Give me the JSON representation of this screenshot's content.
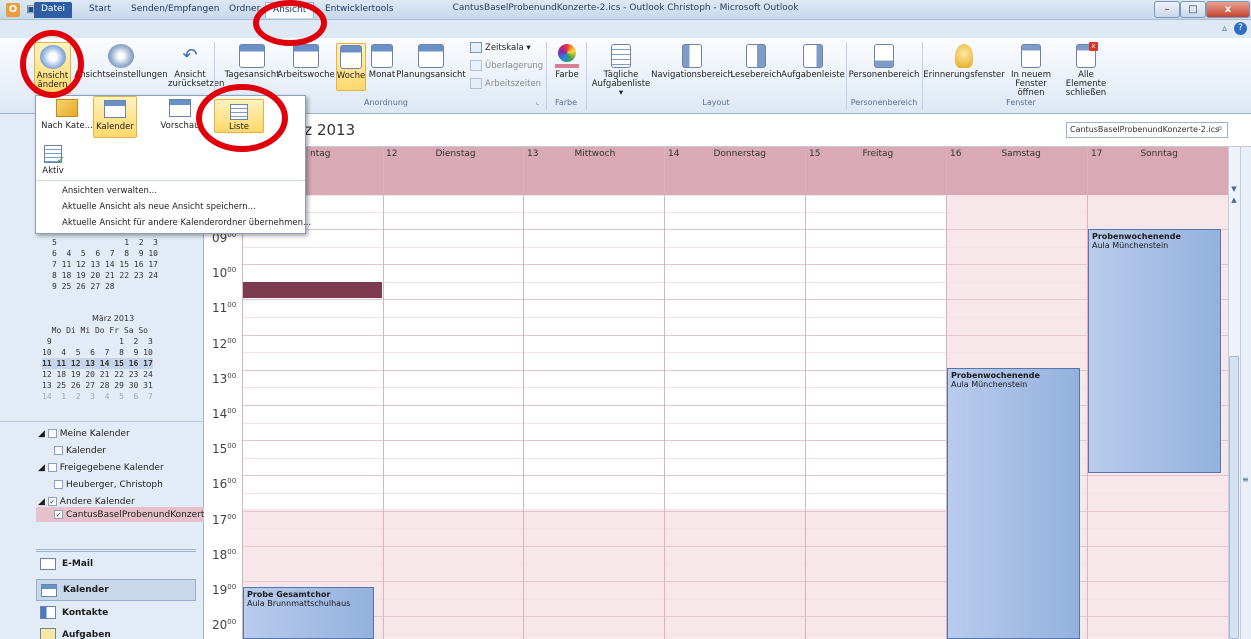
{
  "window": {
    "title": "CantusBaselProbenundKonzerte-2.ics - Outlook Christoph - Microsoft Outlook"
  },
  "qat": {
    "save_icon": "save-icon",
    "undo_icon": "undo-icon"
  },
  "window_controls": {
    "minimize": "–",
    "maximize": "□",
    "close": "x"
  },
  "tabs": [
    {
      "label": "Datei"
    },
    {
      "label": "Start"
    },
    {
      "label": "Senden/Empfangen"
    },
    {
      "label": "Ordner"
    },
    {
      "label": "Ansicht"
    },
    {
      "label": "Entwicklertools"
    }
  ],
  "ribbon": {
    "ansicht_aendern": "Ansicht ändern",
    "ansichtseinstellungen": "Ansichtseinstellungen",
    "ansicht_zuruecksetzen": "Ansicht zurücksetzen",
    "tagesansicht": "Tagesansicht",
    "arbeitswoche": "Arbeitswoche",
    "woche": "Woche",
    "monat": "Monat",
    "planungsansicht": "Planungsansicht",
    "zeitskala": "Zeitskala ▾",
    "ueberlagerung": "Überlagerung",
    "arbeitszeiten": "Arbeitszeiten",
    "farbe": "Farbe",
    "taegliche_aufgabenliste": "Tägliche Aufgabenliste ▾",
    "navigationsbereich": "Navigationsbereich",
    "lesebereich": "Lesebereich",
    "aufgabenleiste": "Aufgabenleiste",
    "personenbereich": "Personenbereich",
    "erinnerungsfenster": "Erinnerungsfenster",
    "in_neuem_fenster": "In neuem Fenster öffnen",
    "alle_schliessen": "Alle Elemente schließen",
    "groups": {
      "anordnung": "Anordnung",
      "farbe": "Farbe",
      "layout": "Layout",
      "personenbereich": "Personenbereich",
      "fenster": "Fenster"
    }
  },
  "dropdown": {
    "views": [
      {
        "label": "Nach Kate..."
      },
      {
        "label": "Kalender"
      },
      {
        "label": "Vorschau"
      },
      {
        "label": "Liste"
      }
    ],
    "aktiv": "Aktiv",
    "menu": [
      "Ansichten verwalten...",
      "Aktuelle Ansicht als neue Ansicht speichern...",
      "Aktuelle Ansicht für andere Kalenderordner übernehmen..."
    ]
  },
  "calendar": {
    "range_title": "März 2013",
    "search_placeholder": "CantusBaselProbenundKonzerte-2.ics",
    "days": [
      {
        "num": "",
        "name": "ntag"
      },
      {
        "num": "12",
        "name": "Dienstag"
      },
      {
        "num": "13",
        "name": "Mittwoch"
      },
      {
        "num": "14",
        "name": "Donnerstag"
      },
      {
        "num": "15",
        "name": "Freitag"
      },
      {
        "num": "16",
        "name": "Samstag"
      },
      {
        "num": "17",
        "name": "Sonntag"
      }
    ],
    "hours": [
      "09",
      "10",
      "11",
      "12",
      "13",
      "14",
      "15",
      "16",
      "17",
      "18",
      "19",
      "20"
    ],
    "minutes": "00",
    "events": [
      {
        "title": "Probenwochenende",
        "location": "Aula Münchenstein"
      },
      {
        "title": "Probenwochenende",
        "location": "Aula Münchenstein"
      },
      {
        "title": "Probe Gesamtchor",
        "location": "Aula Brunnmattschulhaus"
      }
    ]
  },
  "mini_calendar": {
    "feb_partial": [
      "Mo Di Mi Do Fr Sa So",
      "5              1  2  3",
      "6  4  5  6  7  8  9 10",
      "7 11 12 13 14 15 16 17",
      "8 18 19 20 21 22 23 24",
      "9 25 26 27 28"
    ],
    "march_title": "März 2013",
    "march": [
      "  Mo Di Mi Do Fr Sa So",
      " 9              1  2  3",
      "10  4  5  6  7  8  9 10",
      "11 11 12 13 14 15 16 17",
      "12 18 19 20 21 22 23 24",
      "13 25 26 27 28 29 30 31",
      "14  1  2  3  4  5  6  7"
    ]
  },
  "folders": {
    "meine_kalender": "Meine Kalender",
    "kalender": "Kalender",
    "freigegebene": "Freigegebene Kalender",
    "heuberger": "Heuberger, Christoph",
    "andere": "Andere Kalender",
    "cantus": "CantusBaselProbenundKonzerte"
  },
  "nav": [
    "E-Mail",
    "Kalender",
    "Kontakte",
    "Aufgaben"
  ],
  "colors": {
    "accent": "#2d5da3",
    "highlight_circle": "#e0000b",
    "event_blue": "#94b1de",
    "day_header": "#d9a9b5"
  }
}
